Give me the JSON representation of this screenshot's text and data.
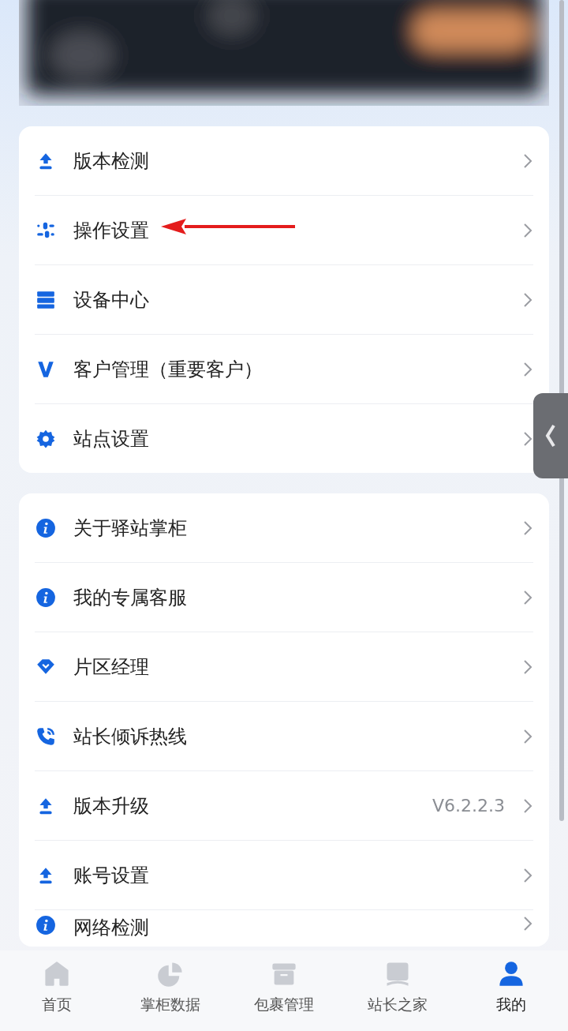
{
  "settings_group": [
    {
      "label": "版本检测"
    },
    {
      "label": "操作设置"
    },
    {
      "label": "设备中心"
    },
    {
      "label": "客户管理（重要客户）"
    },
    {
      "label": "站点设置"
    }
  ],
  "about_group": [
    {
      "label": "关于驿站掌柜"
    },
    {
      "label": "我的专属客服"
    },
    {
      "label": "片区经理"
    },
    {
      "label": "站长倾诉热线"
    },
    {
      "label": "版本升级",
      "value": "V6.2.2.3"
    },
    {
      "label": "账号设置"
    },
    {
      "label": "网络检测"
    }
  ],
  "tab_bar": [
    {
      "label": "首页",
      "selected": false
    },
    {
      "label": "掌柜数据",
      "selected": false
    },
    {
      "label": "包裹管理",
      "selected": false
    },
    {
      "label": "站长之家",
      "selected": false
    },
    {
      "label": "我的",
      "selected": true
    }
  ]
}
